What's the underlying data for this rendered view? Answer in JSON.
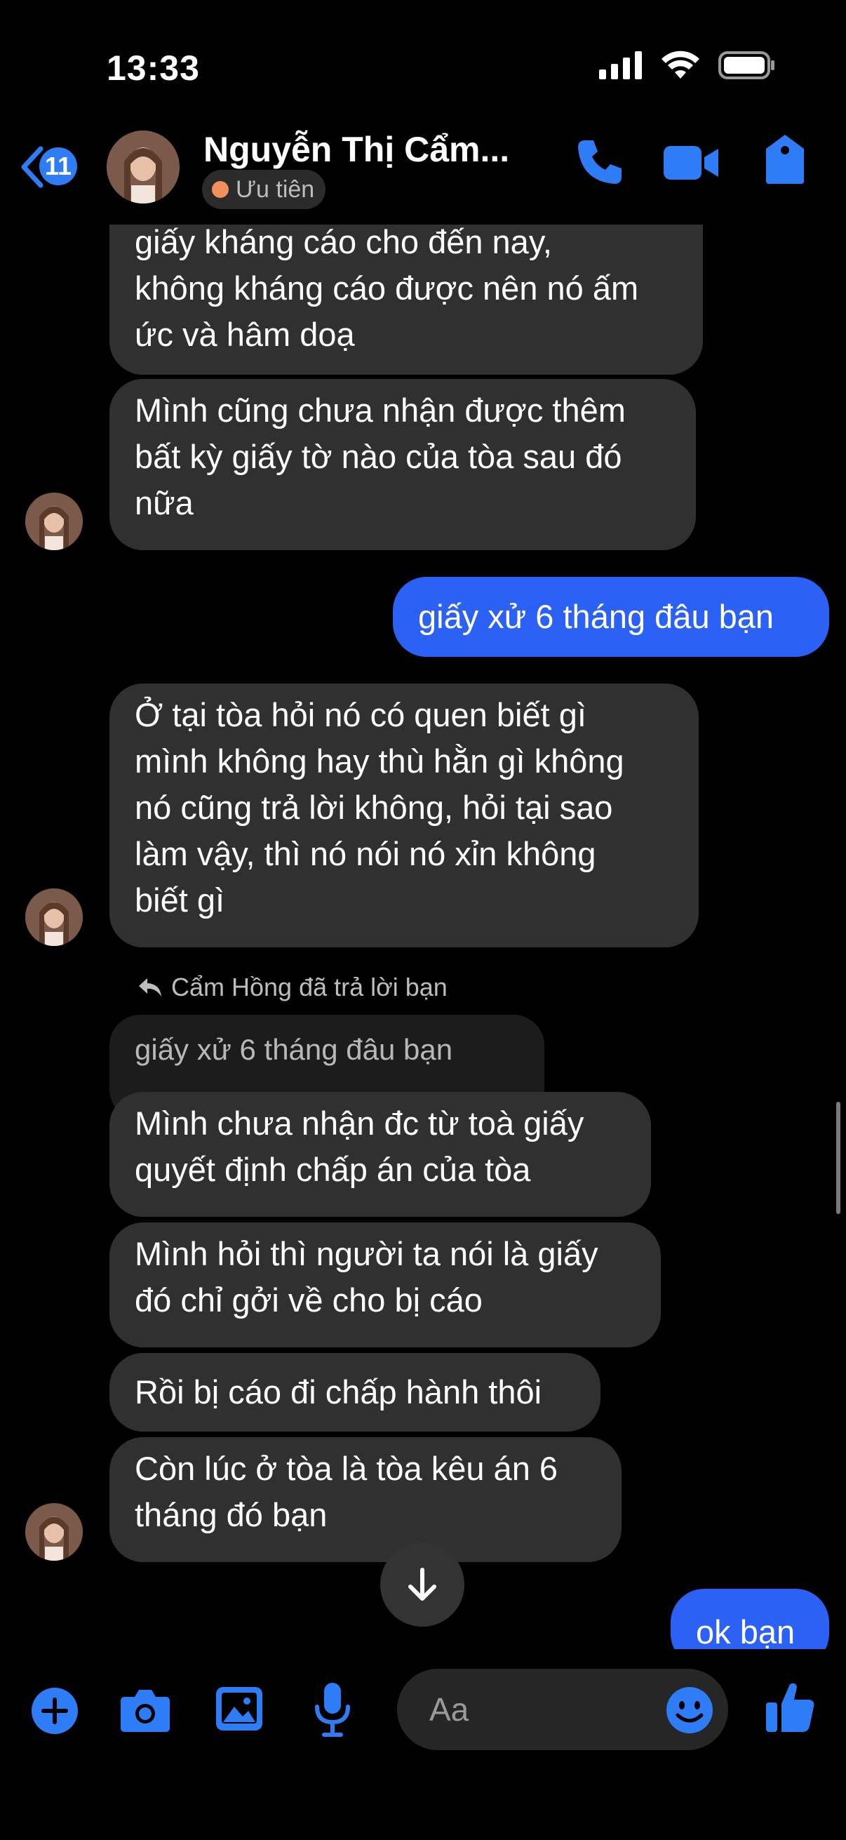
{
  "status": {
    "time": "13:33"
  },
  "header": {
    "unread_count": "11",
    "contact_name": "Nguyễn Thị Cẩm...",
    "priority_label": "Ưu tiên"
  },
  "messages": [
    {
      "text": "giấy kháng cáo cho đến nay,\nkhông kháng cáo được nên nó ấm\nức và hâm doạ"
    },
    {
      "text": "Mình cũng chưa nhận được thêm\nbất kỳ giấy tờ nào của tòa sau đó\nnữa"
    },
    {
      "text": "giấy xử 6 tháng đâu bạn"
    },
    {
      "text": "Ở tại tòa hỏi nó có quen biết gì\nmình không hay thù hằn gì không\nnó cũng trả lời không, hỏi tại sao\nlàm vậy, thì nó nói nó xỉn không\nbiết gì"
    },
    {
      "text": "Mình chưa nhận đc từ toà giấy\nquyết định chấp án của tòa"
    },
    {
      "text": "Mình hỏi thì người ta nói là giấy\nđó chỉ gởi về cho bị cáo"
    },
    {
      "text": "Rồi bị cáo đi chấp hành thôi"
    },
    {
      "text": "Còn lúc ở tòa là tòa kêu án 6\ntháng đó bạn"
    },
    {
      "text": "ok bạn"
    }
  ],
  "reply": {
    "note": "Cẩm Hồng đã trả lời bạn",
    "quoted": "giấy xử 6 tháng đâu bạn"
  },
  "composer": {
    "placeholder": "Aa"
  },
  "colors": {
    "accent": "#2f7df6",
    "outgoing": "#2b62f5",
    "incoming": "#303030"
  }
}
